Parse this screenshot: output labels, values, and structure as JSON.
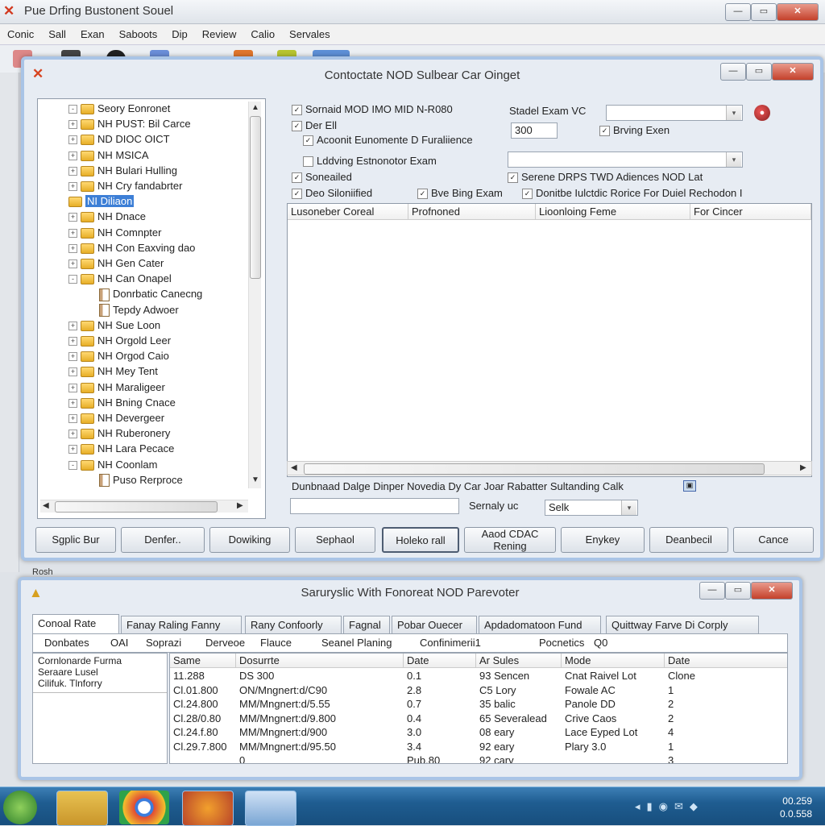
{
  "app": {
    "title": "Pue Drfing Bustonent Souel",
    "menu": [
      "Conic",
      "Sall",
      "Exan",
      "Saboots",
      "Dip",
      "Review",
      "Calio",
      "Servales"
    ],
    "status": "Rosh"
  },
  "dialog1": {
    "title": "Contoctate NOD Sulbear Car Oinget",
    "tree": [
      {
        "label": "Seory Eonronet",
        "indent": 0,
        "icon": "folder",
        "exp": "-"
      },
      {
        "label": "NH PUST: Bil Carce",
        "indent": 0,
        "icon": "folder",
        "exp": "+"
      },
      {
        "label": "ND DIOC OICT",
        "indent": 0,
        "icon": "folder",
        "exp": "+"
      },
      {
        "label": "NH MSICA",
        "indent": 0,
        "icon": "folder",
        "exp": "+"
      },
      {
        "label": "NH Bulari Hulling",
        "indent": 0,
        "icon": "folder",
        "exp": "+"
      },
      {
        "label": "NH Cry fandabrter",
        "indent": 0,
        "icon": "folder",
        "exp": "+"
      },
      {
        "label": "NI Diliaon",
        "indent": 0,
        "icon": "folder",
        "exp": "",
        "selected": true
      },
      {
        "label": "NH Dnace",
        "indent": 0,
        "icon": "folder",
        "exp": "+"
      },
      {
        "label": "NH Comnpter",
        "indent": 0,
        "icon": "folder",
        "exp": "+"
      },
      {
        "label": "NH Con Eaxving dao",
        "indent": 0,
        "icon": "folder",
        "exp": "+"
      },
      {
        "label": "NH Gen Cater",
        "indent": 0,
        "icon": "folder",
        "exp": "+"
      },
      {
        "label": "NH Can Onapel",
        "indent": 0,
        "icon": "folder",
        "exp": "-"
      },
      {
        "label": "Donrbatic Canecng",
        "indent": 1,
        "icon": "doc",
        "exp": ""
      },
      {
        "label": "Tepdy Adwoer",
        "indent": 1,
        "icon": "doc",
        "exp": ""
      },
      {
        "label": "NH Sue Loon",
        "indent": 0,
        "icon": "folder",
        "exp": "+"
      },
      {
        "label": "NH Orgold Leer",
        "indent": 0,
        "icon": "folder",
        "exp": "+"
      },
      {
        "label": "NH Orgod Caio",
        "indent": 0,
        "icon": "folder",
        "exp": "+"
      },
      {
        "label": "NH Mey Tent",
        "indent": 0,
        "icon": "folder",
        "exp": "+"
      },
      {
        "label": "NH Maraligeer",
        "indent": 0,
        "icon": "folder",
        "exp": "+"
      },
      {
        "label": "NH Bning Cnace",
        "indent": 0,
        "icon": "folder",
        "exp": "+"
      },
      {
        "label": "NH Devergeer",
        "indent": 0,
        "icon": "folder",
        "exp": "+"
      },
      {
        "label": "NH Ruberonery",
        "indent": 0,
        "icon": "folder",
        "exp": "+"
      },
      {
        "label": "NH Lara Pecace",
        "indent": 0,
        "icon": "folder",
        "exp": "+"
      },
      {
        "label": "NH Coonlam",
        "indent": 0,
        "icon": "folder",
        "exp": "-"
      },
      {
        "label": "Puso Rerproce",
        "indent": 1,
        "icon": "doc",
        "exp": ""
      }
    ],
    "options": {
      "opt1": "Sornaid MOD IMO MID N-R080",
      "opt2": "Der Ell",
      "opt3": "Acoonit Eunomente D Furaliience",
      "opt4": "Lddving Estnonotor Exam",
      "opt5": "Soneailed",
      "opt6": "Deo Siloniified",
      "opt7": "Bve Bing Exam",
      "opt8": "Donitbe Iulctdic Rorice For Duiel Rechodon I",
      "opt9": "Serene DRPS TWD Adiences NOD Lat",
      "search_label": "Stadel Exam VC",
      "search_value": "",
      "num_value": "300",
      "opt10": "Brving Exen"
    },
    "columns": [
      "Lusoneber Coreal",
      "Profnoned",
      "Lioonloing Feme",
      "For Cincer"
    ],
    "footer_text": "Dunbnaad Dalge Dinper Novedia Dy Car Joar Rabatter Sultanding Calk",
    "sort_label": "Sernaly uc",
    "sort_value": "Selk",
    "buttons": [
      "Sgplic Bur",
      "Denfer..",
      "Dowiking",
      "Sephaol",
      "Holeko rall",
      "Aaod CDAC Rening",
      "Enykey",
      "Deanbecil",
      "Cance"
    ]
  },
  "dialog2": {
    "title": "Saruryslic With Fonoreat NOD Parevoter",
    "tabs": [
      "Conoal Rate",
      "Fanay Raling Fanny",
      "Rany Confoorly",
      "Fagnal",
      "Pobar Ouecer",
      "Apdadomatoon Fund",
      "Quittway Farve Di Corply"
    ],
    "subtabs": [
      "Donbates",
      "OAI",
      "Soprazi",
      "Derveoe",
      "Flauce",
      "Seanel Planing",
      "Confinimerii1",
      "Pocnetics",
      "Q0"
    ],
    "left_pane": [
      "Cornlonarde Furma",
      "Seraare Lusel",
      "Cilifuk. Tlnforry"
    ],
    "grid_headers": [
      "Same",
      "Dosurrte",
      "Date",
      "Ar Sules",
      "Mode",
      "Date"
    ],
    "rows": [
      [
        "11.288",
        "DS 300",
        "0.1",
        "93 Sencen",
        "Cnat Raivel Lot",
        "Clone"
      ],
      [
        "Cl.01.800",
        "ON/Mngnert:d/C90",
        "2.8",
        "C5 Lory",
        "Fowale AC",
        "1"
      ],
      [
        "Cl.24.800",
        "MM/Mngnert:d/5.55",
        "0.7",
        "35 balic",
        "Panole DD",
        "2"
      ],
      [
        "Cl.28/0.80",
        "MM/Mngnert:d/9.800",
        "0.4",
        "65 Severalead",
        "Crive Caos",
        "2"
      ],
      [
        "Cl.24.f.80",
        "MM/Mngnert:d/900",
        "3.0",
        "08 eary",
        "Lace Eyped Lot",
        "4"
      ],
      [
        "Cl.29.7.800",
        "MM/Mngnert:d/95.50",
        "3.4",
        "92 eary",
        "Plary 3.0",
        "1"
      ],
      [
        "",
        "0",
        "Pub.80",
        "92 cary",
        "",
        "3"
      ]
    ]
  },
  "taskbar": {
    "time": "00.259",
    "date": "0.0.558"
  }
}
